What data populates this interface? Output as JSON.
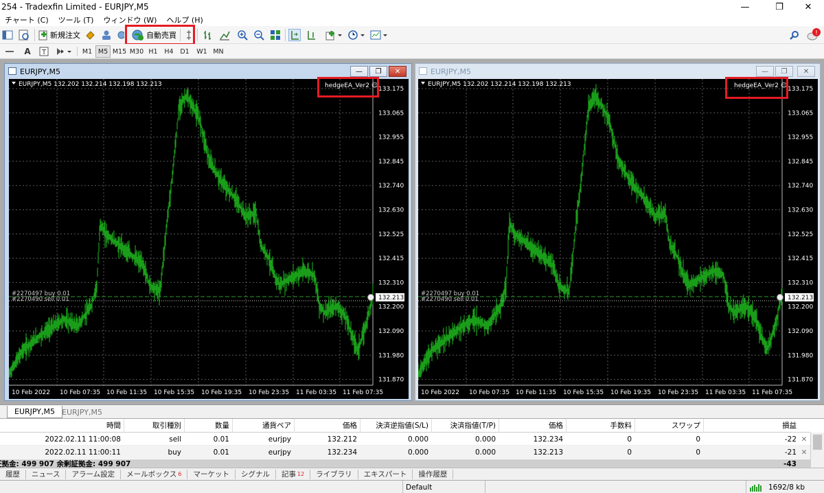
{
  "window": {
    "title": "254 - Tradexfin Limited - EURJPY,M5",
    "controls": [
      "—",
      "❐",
      "✕"
    ]
  },
  "menu": [
    "チャート (C)",
    "ツール (T)",
    "ウィンドウ (W)",
    "ヘルプ (H)"
  ],
  "toolbar": {
    "new_order": "新規注文",
    "auto_trading": "自動売買"
  },
  "timeframes": [
    "M1",
    "M5",
    "M15",
    "M30",
    "H1",
    "H4",
    "D1",
    "W1",
    "MN"
  ],
  "active_timeframe": "M5",
  "colors": {
    "candle": "#1a9e1a",
    "chart_bg": "#000000",
    "highlight": "#e51b23",
    "grid": "#5a5a5a"
  },
  "charts": [
    {
      "window_title": "EURJPY,M5",
      "info": "EURJPY,M5  132.202 132.214 132.198 132.213",
      "ea_label": "hedgeEA_Ver2 ☺",
      "order_buy": "#2270497 buy 0.01",
      "order_sell": "#2270490 sell 0.01",
      "current_price": "132.213",
      "price_labels": [
        "133.175",
        "133.065",
        "132.955",
        "132.845",
        "132.740",
        "132.630",
        "132.525",
        "132.415",
        "132.310",
        "132.200",
        "132.090",
        "131.980",
        "131.870"
      ],
      "time_labels": [
        "10 Feb 2022",
        "10 Feb 07:35",
        "10 Feb 11:35",
        "10 Feb 15:35",
        "10 Feb 19:35",
        "10 Feb 23:35",
        "11 Feb 03:35",
        "11 Feb 07:35"
      ]
    },
    {
      "window_title": "EURJPY,M5",
      "info": "EURJPY,M5  132.202 132.214 132.198 132.213",
      "ea_label": "hedgeEA_Ver2 ☺",
      "order_buy": "#2270497 buy 0.01",
      "order_sell": "#2270490 sell 0.01",
      "current_price": "132.213",
      "price_labels": [
        "133.175",
        "133.065",
        "132.955",
        "132.845",
        "132.740",
        "132.630",
        "132.525",
        "132.415",
        "132.310",
        "132.200",
        "132.090",
        "131.980",
        "131.870"
      ],
      "time_labels": [
        "10 Feb 2022",
        "10 Feb 07:35",
        "10 Feb 11:35",
        "10 Feb 15:35",
        "10 Feb 19:35",
        "10 Feb 23:35",
        "11 Feb 03:35",
        "11 Feb 07:35"
      ]
    }
  ],
  "chart_tabs": [
    "EURJPY,M5",
    "EURJPY,M5"
  ],
  "terminal": {
    "headers": [
      "時間",
      "取引種別",
      "数量",
      "通貨ペア",
      "価格",
      "決済逆指値(S/L)",
      "決済指値(T/P)",
      "価格",
      "手数料",
      "スワップ",
      "損益"
    ],
    "rows": [
      [
        "2022.02.11 11:00:08",
        "sell",
        "0.01",
        "eurjpy",
        "132.212",
        "0.000",
        "0.000",
        "132.234",
        "0",
        "0",
        "-22"
      ],
      [
        "2022.02.11 11:00:11",
        "buy",
        "0.01",
        "eurjpy",
        "132.234",
        "0.000",
        "0.000",
        "132.213",
        "0",
        "0",
        "-21"
      ]
    ],
    "balance": "証拠金: 499 907  余剰証拠金: 499 907",
    "total": "-43"
  },
  "bottom_tabs": [
    {
      "label": "履歴"
    },
    {
      "label": "ニュース"
    },
    {
      "label": "アラーム設定"
    },
    {
      "label": "メールボックス",
      "badge": "6"
    },
    {
      "label": "マーケット"
    },
    {
      "label": "シグナル"
    },
    {
      "label": "記事",
      "badge": "12"
    },
    {
      "label": "ライブラリ"
    },
    {
      "label": "エキスパート"
    },
    {
      "label": "操作履歴"
    }
  ],
  "status": {
    "profile": "Default",
    "traffic": "1692/8 kb"
  }
}
